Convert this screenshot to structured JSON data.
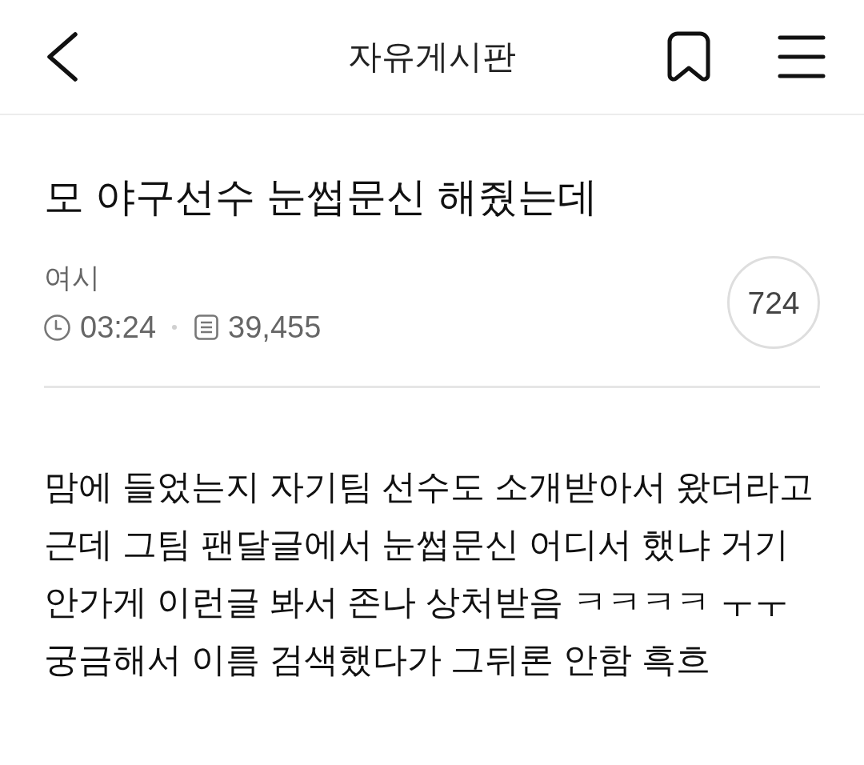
{
  "header": {
    "title": "자유게시판"
  },
  "post": {
    "title": "모 야구선수 눈썹문신 해줬는데",
    "author": "여시",
    "time": "03:24",
    "views": "39,455",
    "comment_count": "724"
  },
  "body": {
    "lines": [
      "맘에 들었는지 자기팀 선수도 소개받아서 왔더라고",
      "근데 그팀 팬달글에서 눈썹문신 어디서 했냐 거기",
      "안가게 이런글 봐서 존나 상처받음 ㅋㅋㅋㅋ ㅜㅜ",
      "궁금해서 이름 검색했다가 그뒤론 안함 흑흐"
    ]
  }
}
